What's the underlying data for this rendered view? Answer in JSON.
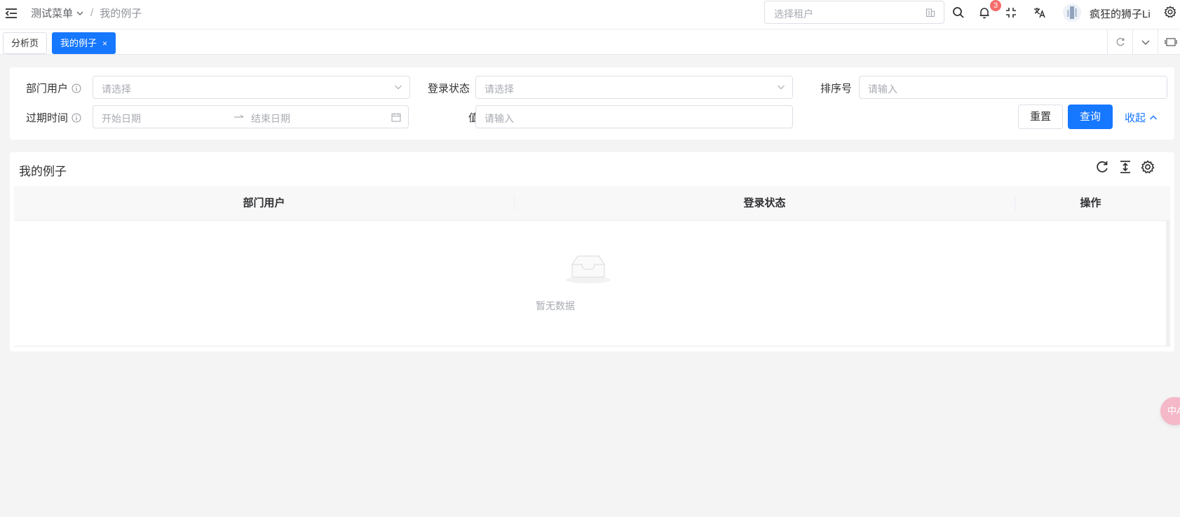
{
  "header": {
    "breadcrumb": [
      "测试菜单",
      "我的例子"
    ],
    "separator": "/",
    "tenant_placeholder": "选择租户",
    "notification_count": "3",
    "username": "疯狂的狮子Li"
  },
  "tabs": {
    "items": [
      {
        "label": "分析页",
        "active": false
      },
      {
        "label": "我的例子",
        "active": true,
        "closable": true
      }
    ],
    "close_glyph": "×"
  },
  "search_form": {
    "dept_user": {
      "label": "部门用户",
      "placeholder": "请选择"
    },
    "login_status": {
      "label": "登录状态",
      "placeholder": "请选择"
    },
    "sort_no": {
      "label": "排序号",
      "placeholder": "请输入"
    },
    "expire_time": {
      "label": "过期时间",
      "start_placeholder": "开始日期",
      "end_placeholder": "结束日期"
    },
    "value": {
      "label": "值",
      "placeholder": "请输入"
    },
    "reset_label": "重置",
    "query_label": "查询",
    "collapse_label": "收起"
  },
  "table": {
    "title": "我的例子",
    "columns": [
      "部门用户",
      "登录状态",
      "操作"
    ],
    "rows": [],
    "empty_text": "暂无数据"
  },
  "floating_button": {
    "label": "中A"
  },
  "colors": {
    "primary": "#1677ff",
    "badge": "#f56c6c",
    "page_bg": "#f4f4f4"
  },
  "icons": [
    "menu-fold-icon",
    "chevron-down-icon",
    "building-icon",
    "search-icon",
    "bell-icon",
    "fullscreen-icon",
    "translate-icon",
    "gear-icon",
    "refresh-icon",
    "maximize-icon",
    "info-icon",
    "calendar-icon",
    "arrow-right-icon",
    "chevron-up-icon",
    "column-height-icon",
    "empty-inbox-icon"
  ]
}
